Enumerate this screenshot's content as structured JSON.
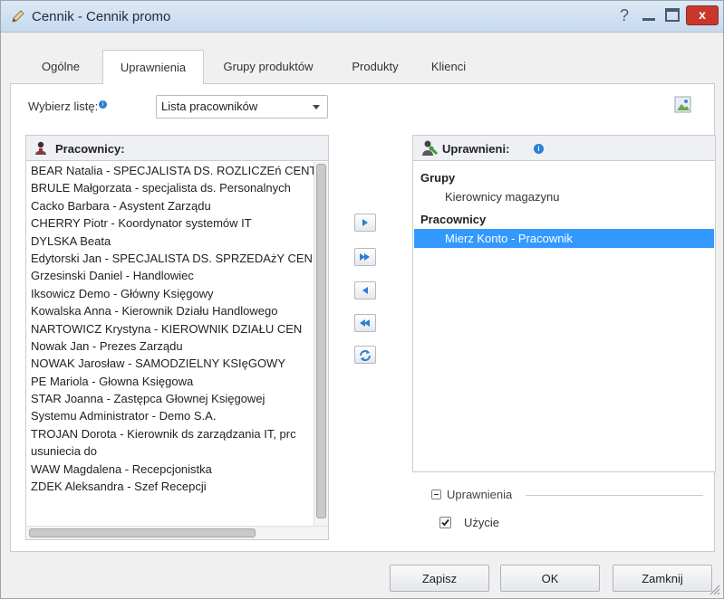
{
  "window": {
    "title": "Cennik - Cennik promo",
    "help_glyph": "?",
    "close_glyph": "x"
  },
  "tabs": [
    {
      "label": "Ogólne",
      "active": false
    },
    {
      "label": "Uprawnienia",
      "active": true
    },
    {
      "label": "Grupy produktów",
      "active": false
    },
    {
      "label": "Produkty",
      "active": false
    },
    {
      "label": "Klienci",
      "active": false
    }
  ],
  "list_select": {
    "label": "Wybierz listę:",
    "info_glyph": "i",
    "value": "Lista pracowników"
  },
  "employees_panel": {
    "title": "Pracownicy:",
    "items": [
      "BEAR Natalia - SPECJALISTA DS. ROZLICZEń CENT",
      "BRULE Małgorzata - specjalista ds. Personalnych",
      "Cacko Barbara - Asystent Zarządu",
      "CHERRY Piotr - Koordynator systemów IT",
      "DYLSKA Beata",
      "Edytorski Jan - SPECJALISTA DS. SPRZEDAżY CEN",
      "Grzesinski Daniel - Handlowiec",
      "Iksowicz Demo - Główny Księgowy",
      "Kowalska Anna - Kierownik Działu Handlowego",
      "NARTOWICZ Krystyna - KIEROWNIK DZIAŁU CEN",
      "Nowak Jan - Prezes Zarządu",
      "NOWAK Jarosław - SAMODZIELNY KSIęGOWY",
      "PE Mariola - Głowna Księgowa",
      "STAR Joanna - Zastępca Głownej Księgowej",
      "Systemu Administrator - Demo S.A.",
      "TROJAN Dorota - Kierownik ds zarządzania IT, prc",
      "usuniecia do",
      "WAW Magdalena - Recepcjonistka",
      "ZDEK Aleksandra - Szef Recepcji"
    ]
  },
  "permissions_panel": {
    "title": "Uprawnieni:",
    "info_glyph": "i",
    "groups_heading": "Grupy",
    "groups": [
      "Kierownicy magazynu"
    ],
    "employees_heading": "Pracownicy",
    "employees": [
      {
        "label": "Mierz Konto - Pracownik",
        "selected": true
      }
    ]
  },
  "permissions_section": {
    "title": "Uprawnienia",
    "usage_label": "Użycie",
    "usage_checked": true
  },
  "footer": {
    "save": "Zapisz",
    "ok": "OK",
    "close": "Zamknij"
  },
  "colors": {
    "selection": "#3399ff",
    "close_button": "#c9372c",
    "info": "#2a7fd4"
  }
}
